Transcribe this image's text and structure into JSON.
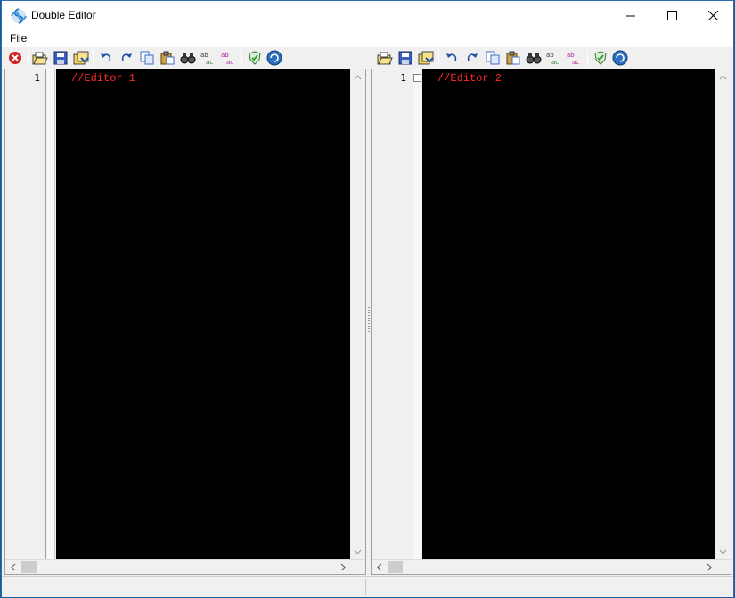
{
  "window": {
    "title": "Double Editor"
  },
  "menu": {
    "items": [
      {
        "label": "File"
      }
    ]
  },
  "toolbar": {
    "buttons": [
      "close-file-icon",
      "open-folder-icon",
      "save-icon",
      "save-all-icon",
      "undo-icon",
      "redo-icon",
      "copy-icon",
      "paste-icon",
      "find-icon",
      "replace-icon",
      "replace-all-icon",
      "shield-icon",
      "refresh-icon"
    ]
  },
  "editors": [
    {
      "line_number": "1",
      "code": "//Editor 1"
    },
    {
      "line_number": "1",
      "fold_marker": "-",
      "code": "//Editor 2"
    }
  ],
  "colors": {
    "editor_bg": "#000000",
    "code_text": "#ff2a2a",
    "window_border": "#2b6cb0"
  }
}
